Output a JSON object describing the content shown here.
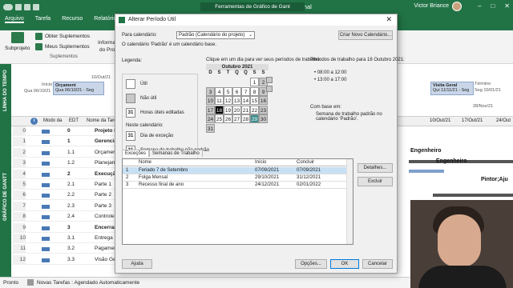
{
  "titlebar": {
    "title": "Projeto Engenharia  -  Project Professional",
    "context_tab": "Ferramentas de Gráfico de Gant",
    "user": "Victor Briance"
  },
  "tabs": [
    "Arquivo",
    "Tarefa",
    "Recurso",
    "Relatório"
  ],
  "ribbon": {
    "subprojeto": "Subprojeto",
    "obter_suplementos": "Obter Suplementos",
    "meus_suplementos": "Meus Suplementos",
    "informacoes": "Informaç...",
    "do_projeto": "do Proj...",
    "group_suplementos": "Suplementos"
  },
  "timeline": {
    "label": "LINHA DO TEMPO",
    "start_label": "Início",
    "start_date": "Qua 06/10/21",
    "date_top": "10/Out/21",
    "task_name": "Orçament",
    "task_date": "Qua 06/10/21 - Seg",
    "date_right": "21",
    "visita_geral": "Visita Geral",
    "visita_dates": "Qui 11/11/21 - Seg",
    "termino": "Término",
    "termino_date": "Seg 10/01/21",
    "date_28": "28/Nov/21"
  },
  "grid": {
    "label": "GRÁFICO DE GANTT",
    "headers": {
      "info": "i",
      "mode": "Modo da",
      "edt": "EDT",
      "name": "Nome da Tarefa"
    },
    "timescale": [
      "10/Out/21",
      "17/Out/21",
      "24/Out"
    ],
    "rows": [
      {
        "num": "0",
        "edt": "0",
        "name": "Projeto Enge",
        "bold": true
      },
      {
        "num": "1",
        "edt": "1",
        "name": "Gerenciam",
        "bold": true
      },
      {
        "num": "2",
        "edt": "1.1",
        "name": "Orçamer",
        "bold": false
      },
      {
        "num": "3",
        "edt": "1.2",
        "name": "Planejam",
        "bold": false
      },
      {
        "num": "4",
        "edt": "2",
        "name": "Execução",
        "bold": true
      },
      {
        "num": "5",
        "edt": "2.1",
        "name": "Parte 1",
        "bold": false
      },
      {
        "num": "6",
        "edt": "2.2",
        "name": "Parte 2",
        "bold": false
      },
      {
        "num": "7",
        "edt": "2.3",
        "name": "Parte 3",
        "bold": false
      },
      {
        "num": "8",
        "edt": "2.4",
        "name": "Controle",
        "bold": false
      },
      {
        "num": "9",
        "edt": "3",
        "name": "Encerrame",
        "bold": true
      },
      {
        "num": "10",
        "edt": "3.1",
        "name": "Entrega",
        "bold": false
      },
      {
        "num": "11",
        "edt": "3.2",
        "name": "Pagamen",
        "bold": false
      },
      {
        "num": "12",
        "edt": "3.3",
        "name": "Visão Ge",
        "bold": false
      }
    ],
    "gantt_labels": [
      "Engenheiro",
      "Engenheiro",
      "Pintor;Aju"
    ]
  },
  "status": {
    "ready": "Pronto",
    "mode": "Novas Tarefas : Agendado Automaticamente"
  },
  "dialog": {
    "title": "Alterar Período Útil",
    "para_calendario_label": "Para calendário:",
    "calendar_value": "Padrão (Calendário do projeto)",
    "criar_btn": "Criar Novo Calendário...",
    "info": "O calendário 'Padrão' é um calendário base.",
    "legenda": "Legenda:",
    "click_hint": "Clique em um dia para ver seus períodos de trabalho:",
    "periods_title": "Períodos de trabalho para 18 Outubro 2021:",
    "periods": [
      "• 08:00 a 12:00",
      "• 13:00 a 17:00"
    ],
    "legend_items": [
      "Útil",
      "Não útil",
      "Horas úteis editadas"
    ],
    "neste_calendario": "Neste calendário:",
    "legend_items2": [
      "Dia de exceção",
      "Semana de trabalho não padrão"
    ],
    "sample_31": "31",
    "com_base": "Com base em:",
    "com_base_text": "Semana de trabalho padrão no calendário 'Padrão'.",
    "calendar": {
      "month": "Outubro 2021",
      "dow": [
        "D",
        "S",
        "T",
        "Q",
        "Q",
        "S",
        "S"
      ],
      "weeks": [
        [
          "",
          "",
          "",
          "",
          "",
          "1",
          "2"
        ],
        [
          "3",
          "4",
          "5",
          "6",
          "7",
          "8",
          "9"
        ],
        [
          "10",
          "11",
          "12",
          "13",
          "14",
          "15",
          "16"
        ],
        [
          "17",
          "18",
          "19",
          "20",
          "21",
          "22",
          "23"
        ],
        [
          "24",
          "25",
          "26",
          "27",
          "28",
          "29",
          "30"
        ],
        [
          "31",
          "",
          "",
          "",
          "",
          "",
          ""
        ]
      ],
      "selected": "18",
      "highlight": "29"
    },
    "tabs": [
      "Exceções",
      "Semanas de Trabalho"
    ],
    "exceptions": {
      "headers": [
        "Nome",
        "Início",
        "Concluir"
      ],
      "rows": [
        {
          "n": "1",
          "name": "Feriado 7 de Setembro",
          "start": "07/09/2021",
          "end": "07/09/2021"
        },
        {
          "n": "2",
          "name": "Folga Mensal",
          "start": "29/10/2021",
          "end": "31/12/2021"
        },
        {
          "n": "3",
          "name": "Recesso final de ano",
          "start": "24/12/2021",
          "end": "02/01/2022"
        }
      ]
    },
    "detalhes_btn": "Detalhes...",
    "excluir_btn": "Excluir",
    "ajuda_btn": "Ajuda",
    "opcoes_btn": "Opções...",
    "ok_btn": "OK",
    "cancelar_btn": "Cancelar"
  }
}
